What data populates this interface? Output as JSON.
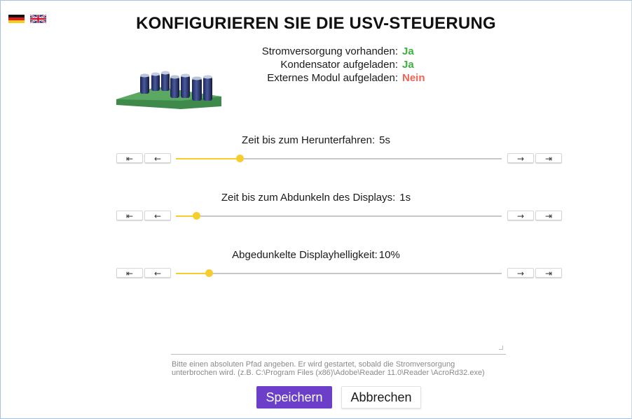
{
  "header": {
    "title": "KONFIGURIEREN SIE DIE USV-STEUERUNG"
  },
  "languages": [
    {
      "name": "Deutsch",
      "icon": "german-flag-icon"
    },
    {
      "name": "English",
      "icon": "uk-flag-icon"
    }
  ],
  "status": [
    {
      "label": "Stromversorgung vorhanden:",
      "value": "Ja",
      "state": "ok"
    },
    {
      "label": "Kondensator aufgeladen:",
      "value": "Ja",
      "state": "ok"
    },
    {
      "label": "Externes Modul aufgeladen:",
      "value": "Nein",
      "state": "bad"
    }
  ],
  "colors": {
    "accent": "#f5cd2e",
    "ok": "#3bb33b",
    "bad": "#f06451",
    "primary": "#6b3fc8"
  },
  "step_buttons": {
    "first": "⇤",
    "prev": "←",
    "next": "→",
    "last": "⇥"
  },
  "sliders": [
    {
      "label": "Zeit bis zum Herunterfahren:",
      "value": "5s",
      "level": 0.195
    },
    {
      "label": "Zeit bis zum Abdunkeln des Displays:",
      "value": "1s",
      "level": 0.063
    },
    {
      "label": "Abgedunkelte Displayhelligkeit:",
      "value": "10%",
      "level": 0.1
    }
  ],
  "path_field": {
    "value": "",
    "hint": "Bitte einen absoluten Pfad angeben. Er wird gestartet, sobald die Stromversorgung unterbrochen wird. (z.B. C:\\Program Files (x86)\\Adobe\\Reader 11.0\\Reader \\AcroRd32.exe)"
  },
  "actions": {
    "save": "Speichern",
    "cancel": "Abbrechen"
  }
}
